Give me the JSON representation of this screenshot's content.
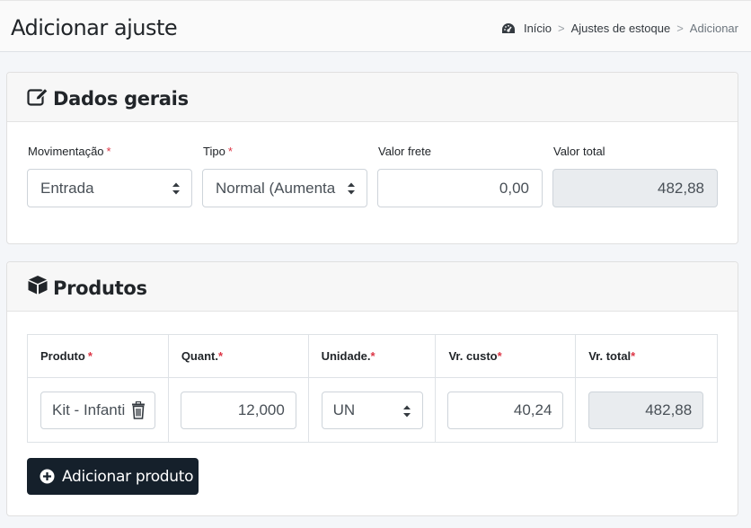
{
  "header": {
    "title": "Adicionar ajuste",
    "breadcrumb": {
      "home": "Início",
      "section": "Ajustes de estoque",
      "current": "Adicionar",
      "separator": ">"
    }
  },
  "dados_gerais": {
    "title": "Dados gerais",
    "icon": "edit-icon",
    "movimentacao": {
      "label": "Movimentação",
      "required": "*",
      "value": "Entrada"
    },
    "tipo": {
      "label": "Tipo",
      "required": "*",
      "value": "Normal (Aumenta"
    },
    "valor_frete": {
      "label": "Valor frete",
      "value": "0,00"
    },
    "valor_total": {
      "label": "Valor total",
      "value": "482,88"
    }
  },
  "produtos": {
    "title": "Produtos",
    "icon": "cube-icon",
    "columns": [
      {
        "label": "Produto",
        "required": "*"
      },
      {
        "label": "Quant.",
        "required": "*"
      },
      {
        "label": "Unidade.",
        "required": "*"
      },
      {
        "label": "Vr. custo",
        "required": "*"
      },
      {
        "label": "Vr. total",
        "required": "*"
      }
    ],
    "rows": [
      {
        "produto": "Kit - Infanti",
        "quantidade": "12,000",
        "unidade": "UN",
        "vr_custo": "40,24",
        "vr_total": "482,88"
      }
    ],
    "add_button": "Adicionar produto"
  },
  "colors": {
    "accent_button": "#15202b",
    "required": "#dc3545",
    "readonly_bg": "#e9ecef"
  }
}
